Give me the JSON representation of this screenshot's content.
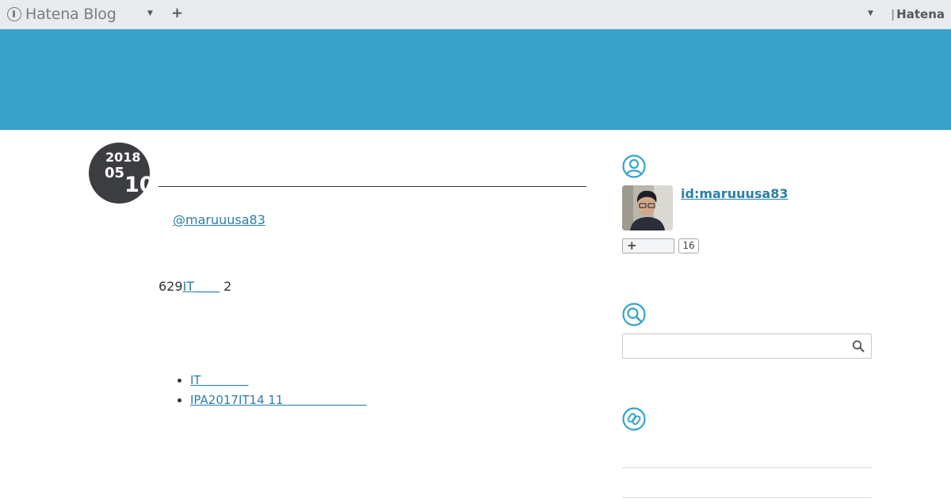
{
  "topbar": {
    "brand": "Hatena Blog",
    "add_label": "+",
    "hatena_label": "Hatena"
  },
  "entry": {
    "date": {
      "year": "2018",
      "month": "05",
      "day": "10"
    },
    "author_link": "@maruuusa83",
    "body_prefix": "629",
    "body_link": "IT＿＿",
    "body_suffix": "2",
    "related": [
      "IT＿＿＿＿",
      "IPA2017IT14 11＿＿＿＿＿＿＿"
    ]
  },
  "sidebar": {
    "profile_id": "id:maruuusa83",
    "subscribe_label": "+",
    "subscribe_count": "16",
    "search_placeholder": ""
  },
  "colors": {
    "banner": "#37a3cb",
    "accent": "#2a7fa8",
    "date_badge": "#3b3d40",
    "topbar": "#e8eaed"
  },
  "icons": {
    "brand": "hatena-blog-logo-icon",
    "caret": "caret-down-icon",
    "profile": "user-icon",
    "search": "search-icon",
    "links": "link-icon"
  }
}
